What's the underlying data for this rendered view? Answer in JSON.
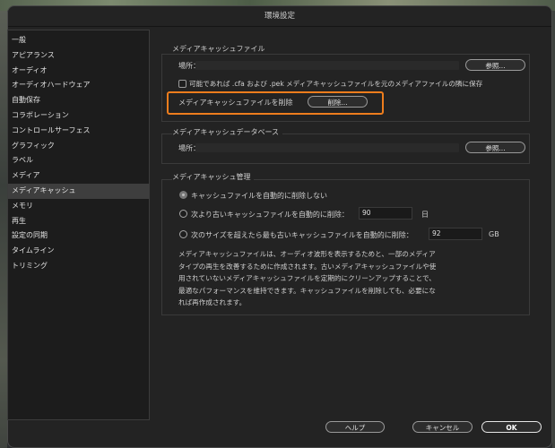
{
  "window": {
    "title": "環境設定"
  },
  "sidebar": {
    "items": [
      {
        "label": "一般"
      },
      {
        "label": "アピアランス"
      },
      {
        "label": "オーディオ"
      },
      {
        "label": "オーディオハードウェア"
      },
      {
        "label": "自動保存"
      },
      {
        "label": "コラボレーション"
      },
      {
        "label": "コントロールサーフェス"
      },
      {
        "label": "グラフィック"
      },
      {
        "label": "ラベル"
      },
      {
        "label": "メディア"
      },
      {
        "label": "メディアキャッシュ",
        "selected": true
      },
      {
        "label": "メモリ"
      },
      {
        "label": "再生"
      },
      {
        "label": "設定の同期"
      },
      {
        "label": "タイムライン"
      },
      {
        "label": "トリミング"
      }
    ]
  },
  "media_cache_files": {
    "title": "メディアキャッシュファイル",
    "location_label": "場所：",
    "browse_label": "参照...",
    "save_next_to_originals_label": "可能であれば .cfa および .pek メディアキャッシュファイルを元のメディアファイルの隣に保存",
    "save_next_to_originals_checked": false,
    "remove_label": "メディアキャッシュファイルを削除",
    "delete_label": "削除..."
  },
  "media_cache_database": {
    "title": "メディアキャッシュデータベース",
    "location_label": "場所：",
    "browse_label": "参照..."
  },
  "media_cache_management": {
    "title": "メディアキャッシュ管理",
    "option_no_delete": "キャッシュファイルを自動的に削除しない",
    "option_older_than": "次より古いキャッシュファイルを自動的に削除：",
    "older_than_value": "90",
    "older_than_unit": "日",
    "option_exceeds_size": "次のサイズを超えたら最も古いキャッシュファイルを自動的に削除：",
    "size_value": "92",
    "size_unit": "GB",
    "selected_option": "no_delete",
    "description_lines": [
      "メディアキャッシュファイルは、オーディオ波形を表示するためと、一部のメディア",
      "タイプの再生を改善するために作成されます。古いメディアキャッシュファイルや使",
      "用されていないメディアキャッシュファイルを定期的にクリーンアップすることで、",
      "最適なパフォーマンスを維持できます。キャッシュファイルを削除しても、必要にな",
      "れば再作成されます。"
    ]
  },
  "footer": {
    "help_label": "ヘルプ",
    "cancel_label": "キャンセル",
    "ok_label": "OK"
  },
  "colors": {
    "highlight": "#ee7d1d",
    "window_bg": "#232323",
    "sidebar_bg": "#1c1c1c",
    "selected_item_bg": "#3e3e3e"
  }
}
